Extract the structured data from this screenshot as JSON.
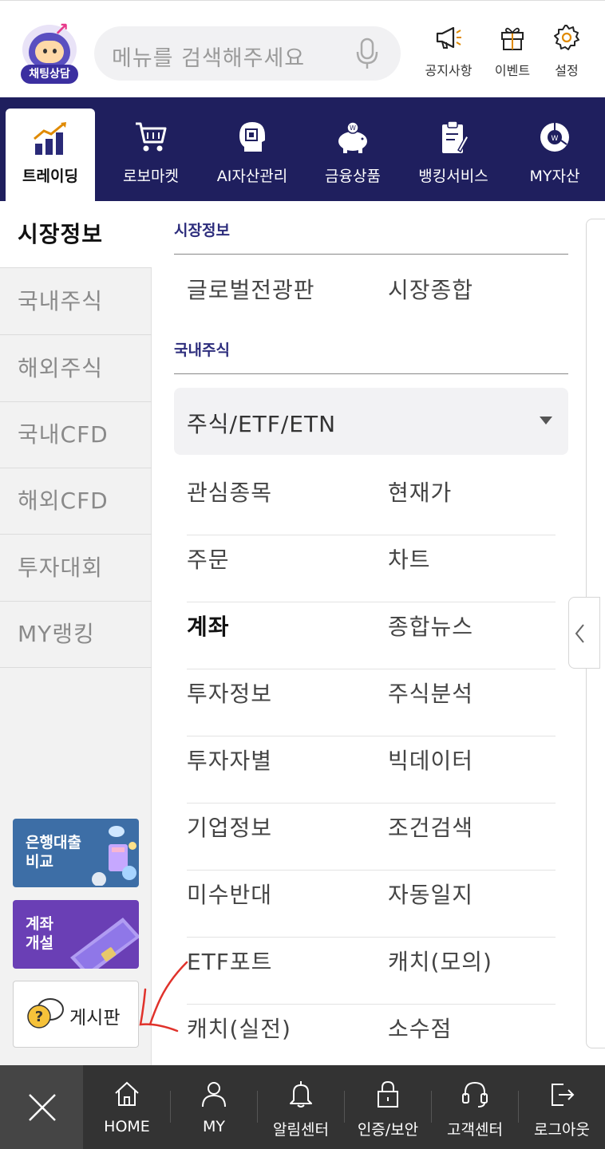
{
  "header": {
    "chatbot_label": "채팅상담",
    "search_placeholder": "메뉴를 검색해주세요",
    "icons": [
      {
        "label": "공지사항",
        "icon": "megaphone-icon"
      },
      {
        "label": "이벤트",
        "icon": "gift-icon"
      },
      {
        "label": "설정",
        "icon": "gear-icon"
      }
    ]
  },
  "nav": {
    "items": [
      {
        "label": "트레이딩",
        "icon": "chart-icon",
        "active": true
      },
      {
        "label": "로보마켓",
        "icon": "cart-icon"
      },
      {
        "label": "AI자산관리",
        "icon": "ai-head-icon"
      },
      {
        "label": "금융상품",
        "icon": "piggy-bank-icon"
      },
      {
        "label": "뱅킹서비스",
        "icon": "clipboard-icon"
      },
      {
        "label": "MY자산",
        "icon": "donut-icon"
      }
    ]
  },
  "sidebar": {
    "items": [
      "시장정보",
      "국내주식",
      "해외주식",
      "국내CFD",
      "해외CFD",
      "투자대회",
      "MY랭킹"
    ],
    "promo_loan": "은행대출\n비교",
    "promo_account": "계좌\n개설",
    "board_label": "게시판"
  },
  "main": {
    "section1_title": "시장정보",
    "section1_links": [
      "글로벌전광판",
      "시장종합"
    ],
    "section2_title": "국내주식",
    "dropdown_value": "주식/ETF/ETN",
    "rows": [
      [
        "관심종목",
        "현재가"
      ],
      [
        "주문",
        "차트"
      ],
      [
        "계좌",
        "종합뉴스"
      ],
      [
        "투자정보",
        "주식분석"
      ],
      [
        "투자자별",
        "빅데이터"
      ],
      [
        "기업정보",
        "조건검색"
      ],
      [
        "미수반대",
        "자동일지"
      ],
      [
        "ETF포트",
        "캐치(모의)"
      ],
      [
        "캐치(실전)",
        "소수점"
      ]
    ]
  },
  "bottom": {
    "items": [
      {
        "label": "HOME",
        "icon": "home-icon"
      },
      {
        "label": "MY",
        "icon": "person-icon"
      },
      {
        "label": "알림센터",
        "icon": "bell-icon"
      },
      {
        "label": "인증/보안",
        "icon": "lock-icon"
      },
      {
        "label": "고객센터",
        "icon": "headset-icon"
      },
      {
        "label": "로그아웃",
        "icon": "logout-icon"
      }
    ]
  },
  "colors": {
    "navbar": "#1f1f5e",
    "section_title": "#2c2c7c",
    "bottom_bar": "#333333"
  }
}
